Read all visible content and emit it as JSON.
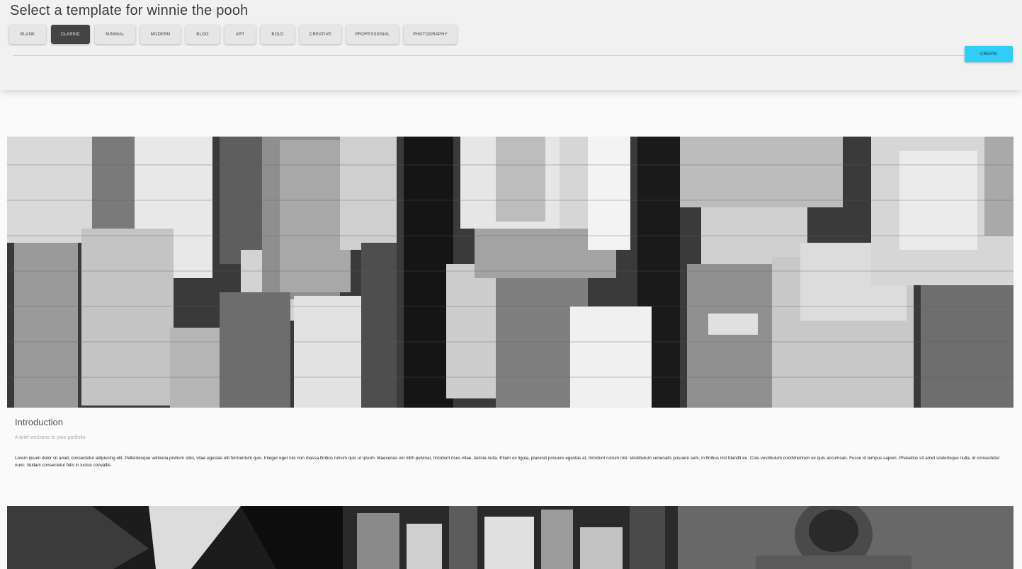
{
  "header": {
    "title": "Select a template for winnie the pooh",
    "templates": [
      {
        "label": "BLANK",
        "active": false
      },
      {
        "label": "CLASSIC",
        "active": true
      },
      {
        "label": "MINIMAL",
        "active": false
      },
      {
        "label": "MODERN",
        "active": false
      },
      {
        "label": "BLOG",
        "active": false
      },
      {
        "label": "ART",
        "active": false
      },
      {
        "label": "BOLD",
        "active": false
      },
      {
        "label": "CREATIVE",
        "active": false
      },
      {
        "label": "PROFESSIONAL",
        "active": false
      },
      {
        "label": "PHOTOGRAPHY",
        "active": false
      }
    ],
    "create_label": "CREATE"
  },
  "preview": {
    "hero_image": "city-aerial-grayscale",
    "intro_title": "Introduction",
    "intro_subtitle": "A brief welcome to your portfolio",
    "intro_body": "Lorem ipsum dolor sit amet, consectetur adipiscing elit. Pellentesque vehicula pretium odio, vitae egestas elit fermentum quis. Integer eget nisi non massa finibus rutrum quis ut ipsum. Maecenas vel nibh pulvinar, tincidunt risus vitae, lacinia nulla. Etiam ex ligula, placerat posuere egestas at, tincidunt rutrum nisl. Vestibulum venenatis posuere sem, in finibus nisl blandit eu. Cras vestibulum condimentum ex quis accumsan. Fusce id tempus sapien. Phasellus sit amet scelerisque nulla, id consectetur nunc. Nullam consectetur felis in luctus convallis.",
    "gallery": [
      "canyon-abstract",
      "city-skyline",
      "robot-portrait"
    ]
  },
  "colors": {
    "accent": "#30cdf7",
    "active_button": "#444444",
    "header_bg": "#f1f1f1"
  }
}
